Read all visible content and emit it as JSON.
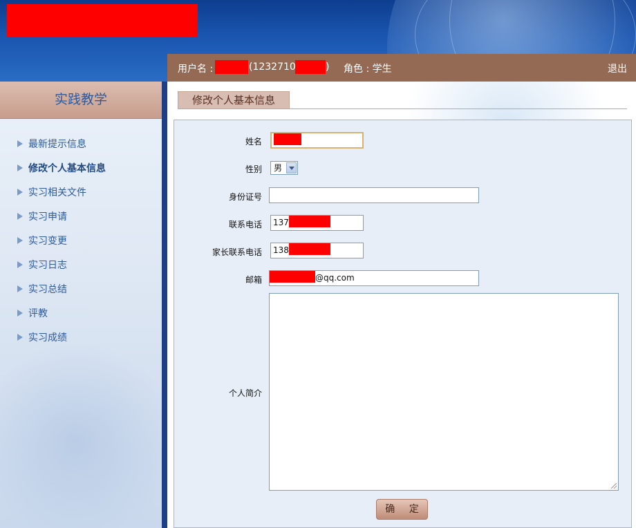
{
  "header": {
    "user_label": "用户名 :",
    "user_id_prefix": "(1232710",
    "user_id_suffix": ")",
    "role": "角色 : 学生",
    "logout": "退出"
  },
  "sidebar": {
    "title": "实践教学",
    "items": [
      {
        "label": "最新提示信息"
      },
      {
        "label": "修改个人基本信息",
        "active": true
      },
      {
        "label": "实习相关文件"
      },
      {
        "label": "实习申请"
      },
      {
        "label": "实习变更"
      },
      {
        "label": "实习日志"
      },
      {
        "label": "实习总结"
      },
      {
        "label": "评教"
      },
      {
        "label": "实习成绩"
      }
    ]
  },
  "main": {
    "tab_title": "修改个人基本信息",
    "form": {
      "name_label": "姓名",
      "gender_label": "性别",
      "gender_value": "男",
      "id_label": "身份证号",
      "id_value": "",
      "phone_label": "联系电话",
      "phone_prefix": "137",
      "parent_phone_label": "家长联系电话",
      "parent_phone_prefix": "138",
      "email_label": "邮箱",
      "email_suffix": "@qq.com",
      "bio_label": "个人简介",
      "bio_value": "",
      "submit_label": "确 定"
    }
  },
  "colors": {
    "header_blue": "#1a56b0",
    "userbar_brown": "#946a55",
    "redaction_red": "#ff0000",
    "link_blue": "#2e5a9c"
  }
}
